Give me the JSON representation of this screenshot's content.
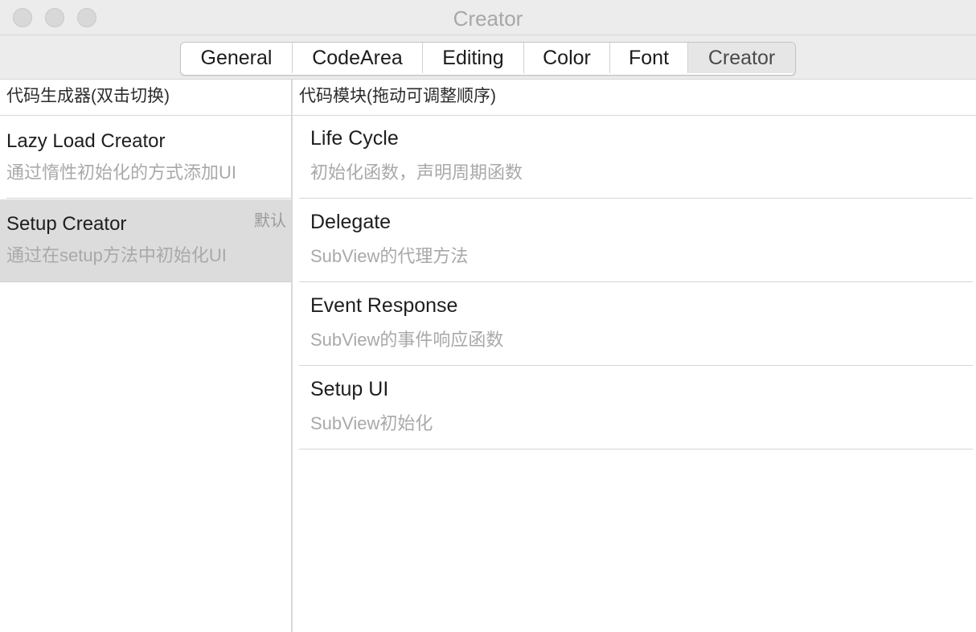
{
  "window": {
    "title": "Creator"
  },
  "tabs": [
    {
      "label": "General"
    },
    {
      "label": "CodeArea"
    },
    {
      "label": "Editing"
    },
    {
      "label": "Color"
    },
    {
      "label": "Font"
    },
    {
      "label": "Creator",
      "selected": true
    }
  ],
  "left": {
    "header": "代码生成器(双击切换)",
    "items": [
      {
        "title": "Lazy Load Creator",
        "description": "通过惰性初始化的方式添加UI",
        "badge": ""
      },
      {
        "title": "Setup Creator",
        "description": "通过在setup方法中初始化UI",
        "badge": "默认",
        "selected": true
      }
    ]
  },
  "right": {
    "header": "代码模块(拖动可调整顺序)",
    "modules": [
      {
        "title": "Life Cycle",
        "description": "初始化函数，声明周期函数"
      },
      {
        "title": "Delegate",
        "description": "SubView的代理方法"
      },
      {
        "title": "Event Response",
        "description": "SubView的事件响应函数"
      },
      {
        "title": "Setup UI",
        "description": "SubView初始化"
      }
    ]
  },
  "colors": {
    "chrome": "#ececec",
    "selection": "#dcdcdc",
    "secondary_text": "#a9a9a9"
  }
}
